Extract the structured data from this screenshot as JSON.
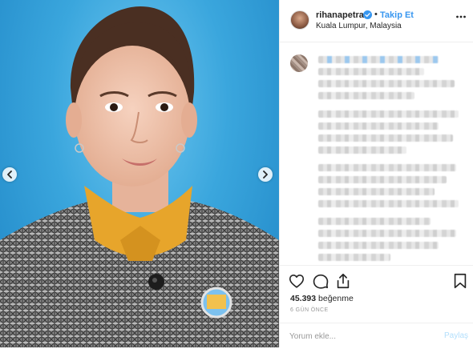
{
  "post": {
    "photo": {
      "prev_icon": "chevron-left-icon",
      "next_icon": "chevron-right-icon",
      "background_color": "#3aa6dd"
    },
    "header": {
      "username": "rihanapetra",
      "verified_icon": "verified-badge-icon",
      "separator": "•",
      "follow_label": "Takip Et",
      "location": "Kuala Lumpur, Malaysia",
      "more_icon": "ellipsis-icon"
    },
    "caption": {
      "state": "blurred"
    },
    "actions": {
      "like_icon": "heart-icon",
      "comment_icon": "comment-bubble-icon",
      "share_icon": "share-upload-icon",
      "save_icon": "bookmark-icon",
      "like_count": "45.393",
      "likes_suffix": " beğenme",
      "time_ago": "6 GÜN ÖNCE"
    },
    "comment_box": {
      "placeholder": "Yorum ekle...",
      "submit_label": "Paylaş"
    },
    "colors": {
      "link_blue": "#3897f0",
      "disabled_blue": "#b2dffc",
      "border": "#efefef"
    }
  }
}
